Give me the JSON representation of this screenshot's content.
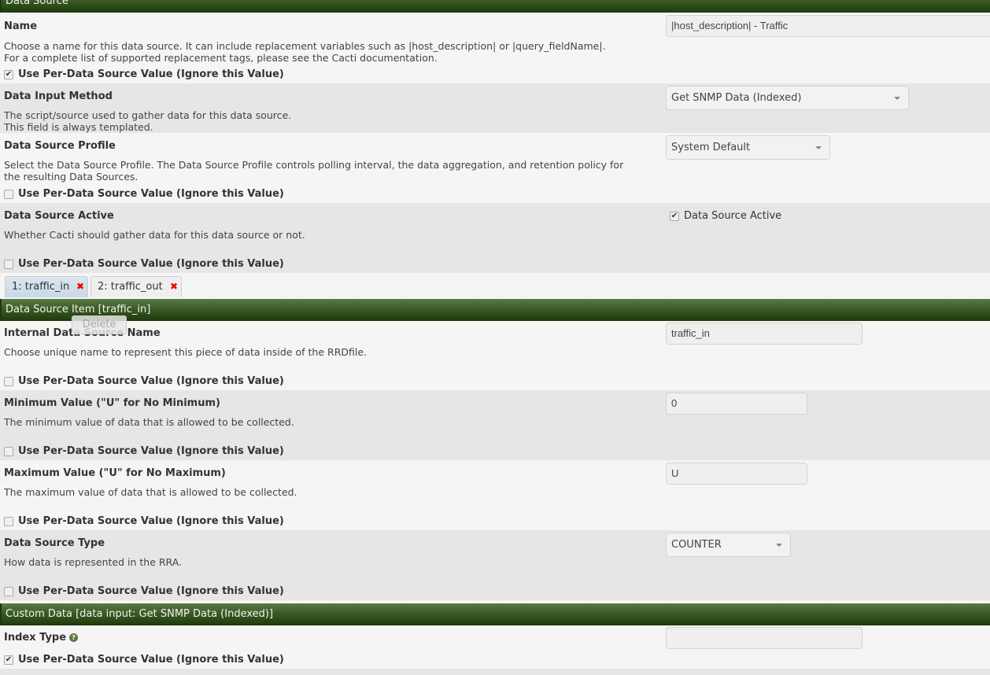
{
  "sections": {
    "data_source": "Data Source",
    "data_source_item": "Data Source Item [traffic_in]",
    "custom_data": "Custom Data [data input: Get SNMP Data (Indexed)]"
  },
  "per_ds_label": "Use Per-Data Source Value (Ignore this Value)",
  "fields": {
    "name": {
      "label": "Name",
      "desc1": "Choose a name for this data source. It can include replacement variables such as |host_description| or |query_fieldName|.",
      "desc2": "For a complete list of supported replacement tags, please see the Cacti documentation.",
      "value": "|host_description| - Traffic",
      "per_ds_checked": true
    },
    "input_method": {
      "label": "Data Input Method",
      "desc1": "The script/source used to gather data for this data source.",
      "desc2": "This field is always templated.",
      "value": "Get SNMP Data (Indexed)"
    },
    "profile": {
      "label": "Data Source Profile",
      "desc1": "Select the Data Source Profile. The Data Source Profile controls polling interval, the data aggregation, and retention policy for",
      "desc2": "the resulting Data Sources.",
      "value": "System Default",
      "per_ds_checked": false
    },
    "active": {
      "label": "Data Source Active",
      "desc1": "Whether Cacti should gather data for this data source or not.",
      "checkbox_label": "Data Source Active",
      "checked": true,
      "per_ds_checked": false
    },
    "internal_name": {
      "label": "Internal Data Source Name",
      "desc1": "Choose unique name to represent this piece of data inside of the RRDfile.",
      "value": "traffic_in",
      "per_ds_checked": false
    },
    "min_value": {
      "label": "Minimum Value (\"U\" for No Minimum)",
      "desc1": "The minimum value of data that is allowed to be collected.",
      "value": "0",
      "per_ds_checked": false
    },
    "max_value": {
      "label": "Maximum Value (\"U\" for No Maximum)",
      "desc1": "The maximum value of data that is allowed to be collected.",
      "value": "U",
      "per_ds_checked": false
    },
    "ds_type": {
      "label": "Data Source Type",
      "desc1": "How data is represented in the RRA.",
      "value": "COUNTER",
      "per_ds_checked": false
    },
    "index_type": {
      "label": "Index Type",
      "value": "",
      "per_ds_checked": true
    }
  },
  "tabs": [
    {
      "label": "1: traffic_in",
      "active": true
    },
    {
      "label": "2: traffic_out",
      "active": false
    }
  ],
  "tooltip": "Delete",
  "icons": {
    "check": "✔",
    "delete": "✖",
    "help": "?"
  }
}
